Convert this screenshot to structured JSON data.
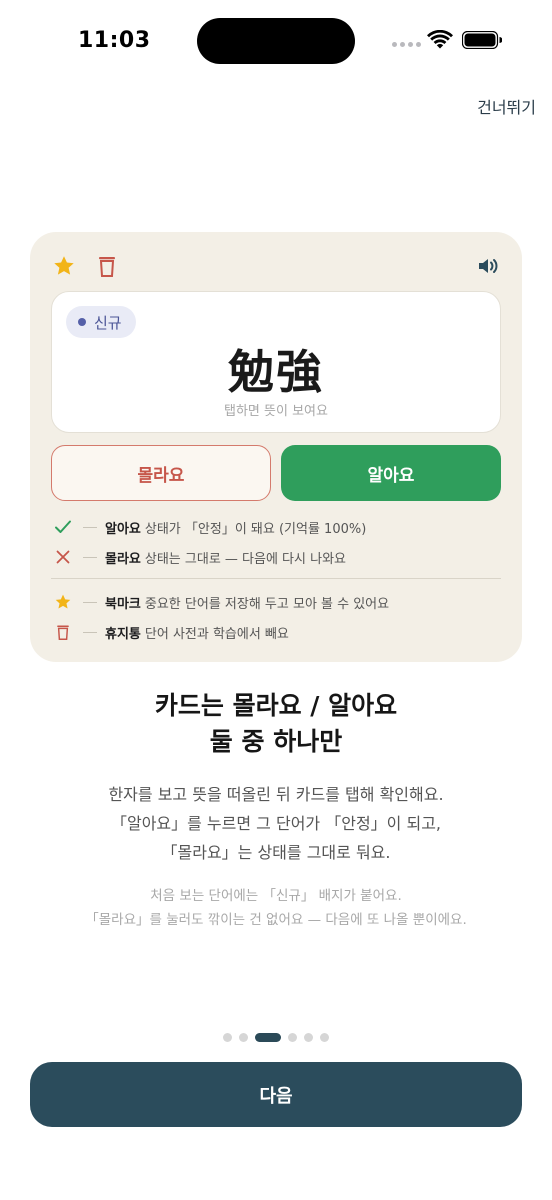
{
  "status_bar": {
    "time": "11:03"
  },
  "header": {
    "skip_label": "건너뛰기"
  },
  "card": {
    "badge_label": "신규",
    "hanja": "勉強",
    "hint": "탭하면 뜻이 보여요",
    "unknown_button": "몰라요",
    "known_button": "알아요",
    "legend": [
      {
        "icon": "check-icon",
        "key": "알아요",
        "desc": "상태가 「안정」이 돼요 (기억률 100%)",
        "color": "#2f9e5c"
      },
      {
        "icon": "x-icon",
        "key": "몰라요",
        "desc": "상태는 그대로 — 다음에 다시 나와요",
        "color": "#c6564a"
      },
      {
        "icon": "star-icon",
        "key": "북마크",
        "desc": "중요한 단어를 저장해 두고 모아 볼 수 있어요",
        "color": "#f2b418"
      },
      {
        "icon": "trash-icon",
        "key": "휴지통",
        "desc": "단어 사전과 학습에서 빼요",
        "color": "#c6564a"
      }
    ]
  },
  "headline": {
    "line1": "카드는 몰라요 / 알아요",
    "line2": "둘 중 하나만"
  },
  "body": {
    "line1": "한자를 보고 뜻을 떠올린 뒤 카드를 탭해 확인해요.",
    "line2": "「알아요」를 누르면 그 단어가 「안정」이 되고,",
    "line3": "「몰라요」는 상태를 그대로 둬요."
  },
  "sub": {
    "line1": "처음 보는 단어에는 「신규」 배지가 붙어요.",
    "line2": "「몰라요」를 눌러도 깎이는 건 없어요 — 다음에 또 나올 뿐이에요."
  },
  "pagination": {
    "total": 6,
    "current": 3
  },
  "footer": {
    "next_label": "다음"
  }
}
